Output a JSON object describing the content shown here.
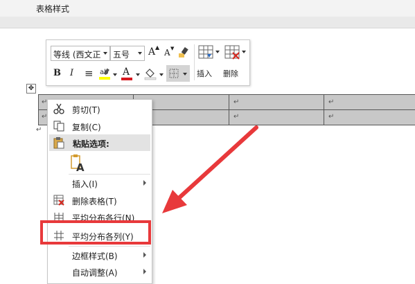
{
  "ribbon": {
    "tab_label": "表格样式"
  },
  "toolbar": {
    "font_name": "等线 (西文正",
    "font_size": "五号",
    "grow_font": "A",
    "shrink_font": "A",
    "bold": "B",
    "italic": "I",
    "align": "≡",
    "font_color": "A",
    "insert_label": "插入",
    "delete_label": "删除"
  },
  "table": {
    "cell_mark": "↵",
    "colors": {
      "header_fill": "#c8c8c8",
      "border": "#555555"
    }
  },
  "context_menu": {
    "cut": "剪切(T)",
    "copy": "复制(C)",
    "paste_options": "粘贴选项:",
    "insert": "插入(I)",
    "delete_table": "删除表格(T)",
    "distribute_rows": "平均分布各行(N)",
    "distribute_columns": "平均分布各列(Y)",
    "border_styles": "边框样式(B)",
    "autofit": "自动调整(A)"
  },
  "highlight": {
    "color": "#e8393b"
  },
  "icons": [
    "table-move-icon",
    "scissors-icon",
    "copy-icon",
    "clipboard-icon",
    "paste-keep-text-icon",
    "insert-table-icon",
    "delete-table-icon",
    "distribute-rows-icon",
    "distribute-columns-icon",
    "format-painter-icon",
    "highlighter-icon",
    "shading-icon",
    "borders-icon"
  ]
}
